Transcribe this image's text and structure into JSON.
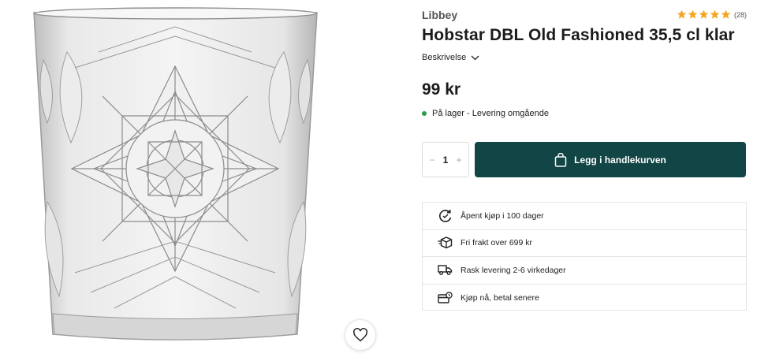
{
  "product": {
    "brand": "Libbey",
    "title": "Hobstar DBL Old Fashioned 35,5 cl klar",
    "rating": {
      "stars": 5,
      "count_text": "(28)"
    },
    "description_toggle": "Beskrivelse",
    "price": "99 kr",
    "stock": {
      "text": "På lager - Levering omgående",
      "status_color": "#2e9a47"
    }
  },
  "purchase": {
    "quantity": "1",
    "minus": "−",
    "plus": "+",
    "add_to_cart_label": "Legg i handlekurven",
    "button_color": "#124545"
  },
  "benefits": [
    {
      "icon": "return-icon",
      "text": "Åpent kjøp i 100 dager"
    },
    {
      "icon": "package-icon",
      "text": "Fri frakt over 699 kr"
    },
    {
      "icon": "truck-icon",
      "text": "Rask levering 2-6 virkedager"
    },
    {
      "icon": "card-icon",
      "text": "Kjøp nå, betal senere"
    }
  ],
  "colors": {
    "star": "#f2a623",
    "accent": "#124545"
  }
}
